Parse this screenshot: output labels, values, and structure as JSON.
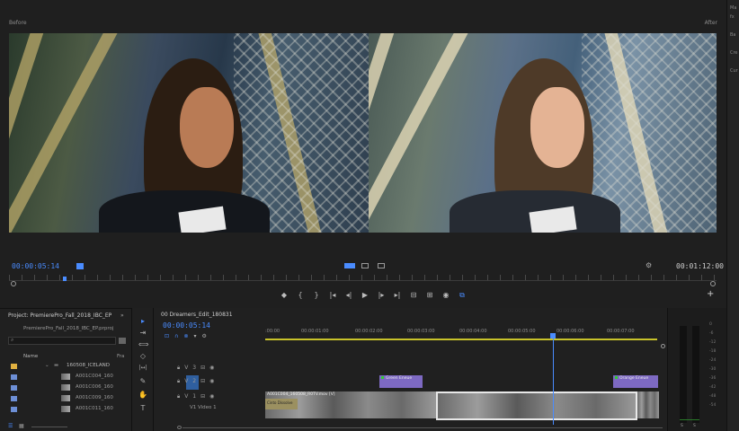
{
  "monitor": {
    "before_label": "Before",
    "after_label": "After",
    "playhead_timecode": "00:00:05:14",
    "duration_timecode": "00:01:12:00",
    "transport_glyphs": [
      "◆",
      "{",
      "}",
      "|◂",
      "◂|",
      "▶",
      "|▸",
      "▸|",
      "⊟",
      "⊞",
      "◉",
      "⧉"
    ],
    "add_glyph": "+"
  },
  "right_panel": {
    "items": [
      "Ma",
      "fx",
      "Ba",
      "Cre",
      "Cur"
    ]
  },
  "project": {
    "tab_title": "Project: PremierePro_Fall_2018_IBC_EP",
    "tab_more": "»",
    "file_name": "PremierePro_Fall_2018_IBC_EP.prproj",
    "column_name": "Name",
    "column_fr": "Fra",
    "folder": "160508_ICELAND",
    "items": [
      {
        "name": "A001C004_160",
        "color": "#6d8fd6"
      },
      {
        "name": "A001C006_160",
        "color": "#6d8fd6"
      },
      {
        "name": "A001C009_160",
        "color": "#6d8fd6"
      },
      {
        "name": "A001C011_160",
        "color": "#6d8fd6"
      }
    ],
    "folder_color": "#e0b040"
  },
  "tools": {
    "glyphs": [
      "▸",
      "⇥",
      "⟺",
      "◇",
      "|↔|",
      "✎",
      "✋",
      "T"
    ]
  },
  "timeline": {
    "tab_title": "00 Dreamers_Edit_180831",
    "timecode": "00:00:05:14",
    "ruler_labels": [
      ":00:00",
      "00:00:01:00",
      "00:00:02:00",
      "00:00:03:00",
      "00:00:04:00",
      "00:00:05:00",
      "00:00:06:00",
      "00:00:07:00"
    ],
    "tracks": [
      {
        "id": "V3",
        "label": "V3"
      },
      {
        "id": "V2",
        "label": "V2"
      },
      {
        "id": "V1",
        "label": "V1",
        "name": "Video 1"
      }
    ],
    "v1_clip_label": "A001C004_160508_R0TV.mov [V]",
    "clip_green": "Green Eneue",
    "clip_orange": "Orange Eneue",
    "adjust_label": "Cinto Dissolve",
    "playhead_fraction": 0.735
  },
  "meter": {
    "labels": [
      "0",
      "-6",
      "-12",
      "-18",
      "-24",
      "-30",
      "-36",
      "-42",
      "-48",
      "-54"
    ],
    "bottom_labels": [
      "S",
      "S"
    ]
  },
  "colors": {
    "accent_blue": "#4a8cff",
    "clip_purple": "#7d69c2",
    "work_area": "#c8c32a"
  }
}
